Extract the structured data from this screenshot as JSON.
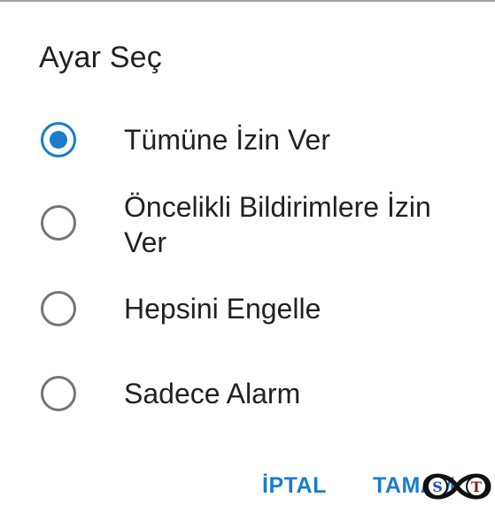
{
  "dialog": {
    "title": "Ayar Seç"
  },
  "options": [
    {
      "label": "Tümüne İzin Ver",
      "selected": true
    },
    {
      "label": "Öncelikli Bildirimlere İzin Ver",
      "selected": false
    },
    {
      "label": "Hepsini Engelle",
      "selected": false
    },
    {
      "label": "Sadece Alarm",
      "selected": false
    }
  ],
  "actions": {
    "cancel_label": "İPTAL",
    "ok_label": "TAMAM"
  },
  "watermark": {
    "letters": [
      "S",
      "T"
    ],
    "icon": "infinity-logo-icon"
  },
  "colors": {
    "accent": "#1a7ccc",
    "radio_unchecked": "#757575",
    "text": "#212121"
  }
}
